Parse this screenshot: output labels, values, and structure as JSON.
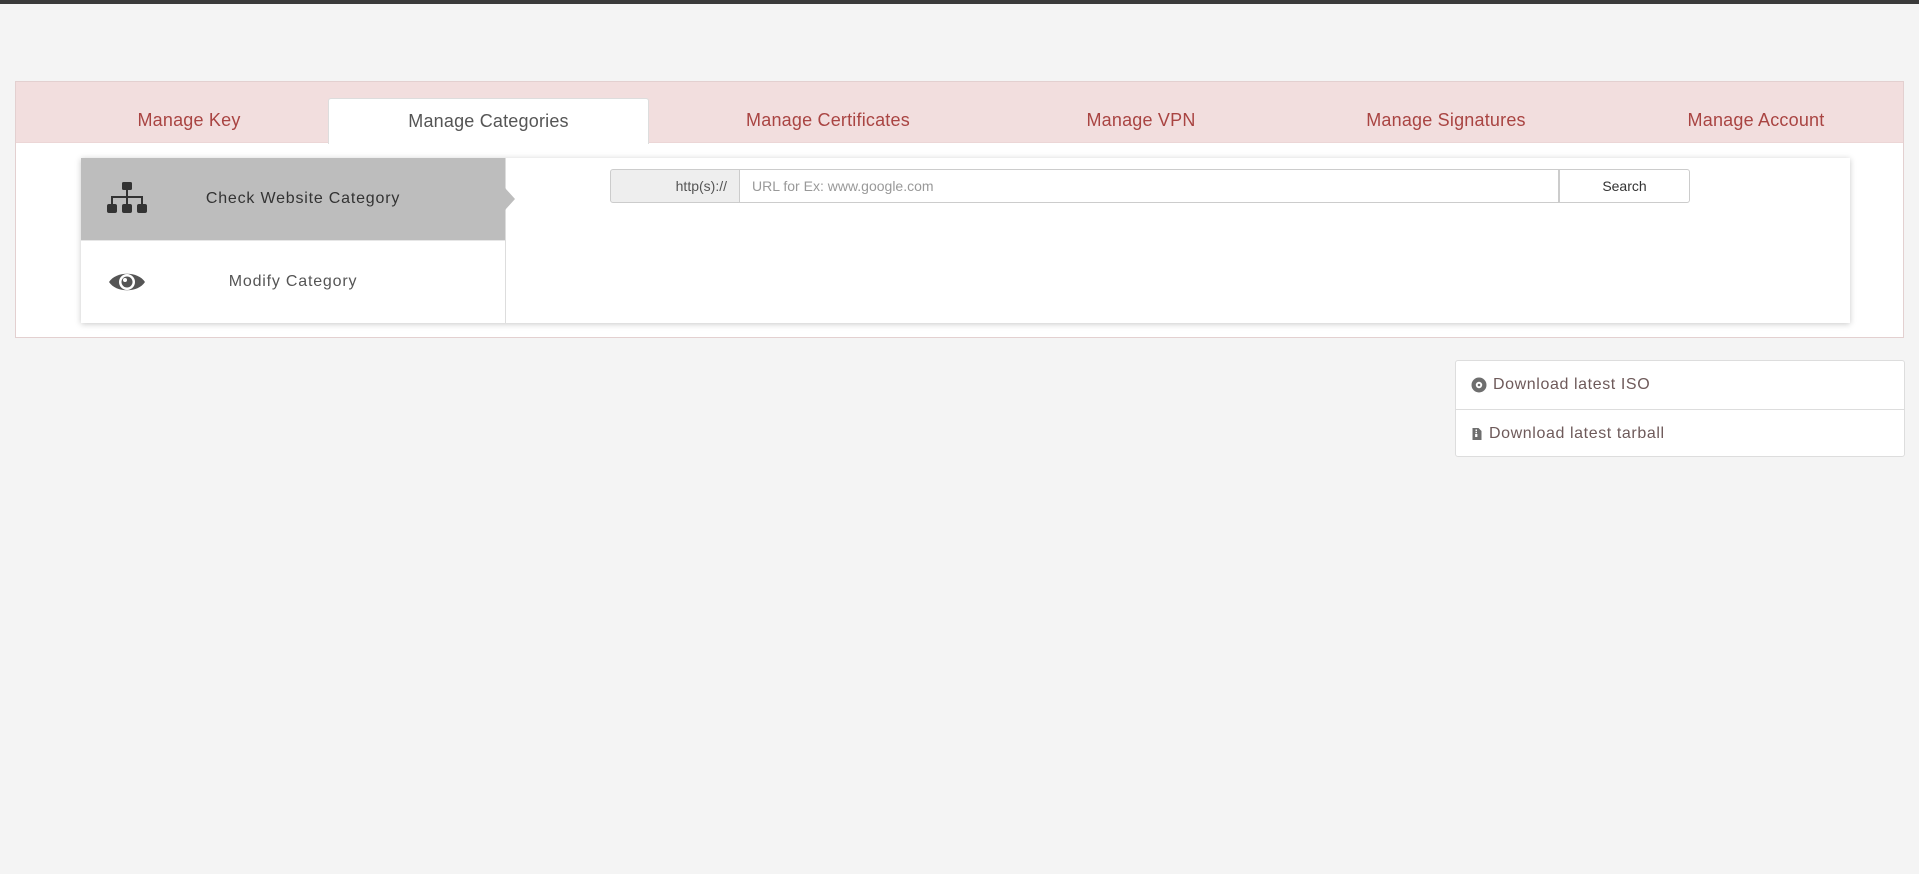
{
  "tabs": [
    {
      "label": "Manage Key",
      "active": false
    },
    {
      "label": "Manage Categories",
      "active": true
    },
    {
      "label": "Manage Certificates",
      "active": false
    },
    {
      "label": "Manage VPN",
      "active": false
    },
    {
      "label": "Manage Signatures",
      "active": false
    },
    {
      "label": "Manage Account",
      "active": false
    }
  ],
  "sidebar": {
    "items": [
      {
        "label": "Check Website Category",
        "icon": "sitemap-icon",
        "active": true
      },
      {
        "label": "Modify Category",
        "icon": "eye-icon",
        "active": false
      }
    ]
  },
  "search": {
    "prefix": "http(s)://",
    "placeholder": "URL for Ex: www.google.com",
    "value": "",
    "button_label": "Search"
  },
  "downloads": {
    "items": [
      {
        "label": "Download latest ISO",
        "icon": "disc-icon"
      },
      {
        "label": "Download latest tarball",
        "icon": "file-archive-icon"
      }
    ]
  },
  "colors": {
    "tabbar_bg": "#f2dede",
    "tab_text": "#a94442",
    "active_sidebar_bg": "#bdbdbd",
    "page_bg": "#f4f4f4"
  }
}
